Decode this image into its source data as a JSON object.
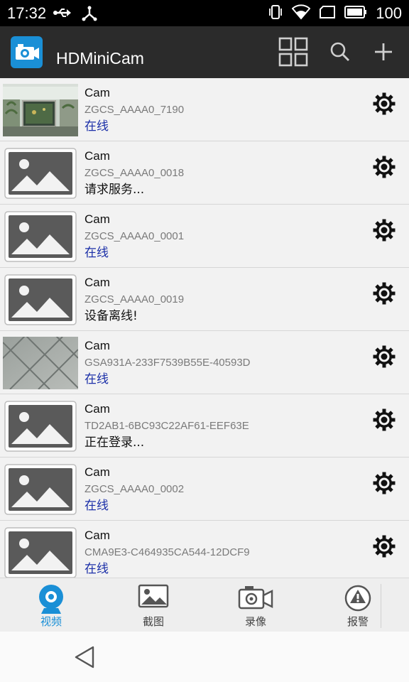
{
  "status_bar": {
    "time": "17:32",
    "battery_text": "100",
    "icons": [
      "usb-icon",
      "usb-tether-icon",
      "vibrate-icon",
      "wifi-icon",
      "sim-icon",
      "battery-icon"
    ]
  },
  "app_bar": {
    "title": "HDMiniCam",
    "logo_icon": "camera-logo-icon",
    "actions": [
      "grid-view-icon",
      "search-icon",
      "add-icon"
    ]
  },
  "cameras": [
    {
      "name": "Cam",
      "id": "ZGCS_AAAA0_7190",
      "status": "在线",
      "online": true,
      "thumb": "photo-aquarium"
    },
    {
      "name": "Cam",
      "id": "ZGCS_AAAA0_0018",
      "status": "请求服务...",
      "online": false,
      "thumb": "placeholder"
    },
    {
      "name": "Cam",
      "id": "ZGCS_AAAA0_0001",
      "status": "在线",
      "online": true,
      "thumb": "placeholder"
    },
    {
      "name": "Cam",
      "id": "ZGCS_AAAA0_0019",
      "status": "设备离线!",
      "online": false,
      "thumb": "placeholder"
    },
    {
      "name": "Cam",
      "id": "GSA931A-233F7539B55E-40593D",
      "status": "在线",
      "online": true,
      "thumb": "photo-tiles"
    },
    {
      "name": "Cam",
      "id": "TD2AB1-6BC93C22AF61-EEF63E",
      "status": "正在登录...",
      "online": false,
      "thumb": "placeholder"
    },
    {
      "name": "Cam",
      "id": "ZGCS_AAAA0_0002",
      "status": "在线",
      "online": true,
      "thumb": "placeholder"
    },
    {
      "name": "Cam",
      "id": "CMA9E3-C464935CA544-12DCF9",
      "status": "在线",
      "online": true,
      "thumb": "placeholder"
    }
  ],
  "colors": {
    "accent": "#1a8fd6",
    "online_text": "#1b2fa8",
    "app_bar_bg": "#2b2b2b"
  },
  "tabs": [
    {
      "label": "视频",
      "icon": "video-tab-icon",
      "active": true
    },
    {
      "label": "截图",
      "icon": "screenshot-tab-icon",
      "active": false
    },
    {
      "label": "录像",
      "icon": "recording-tab-icon",
      "active": false
    },
    {
      "label": "报警",
      "icon": "alarm-tab-icon",
      "active": false
    }
  ],
  "nav_bar": {
    "back_icon": "back-triangle-icon"
  }
}
